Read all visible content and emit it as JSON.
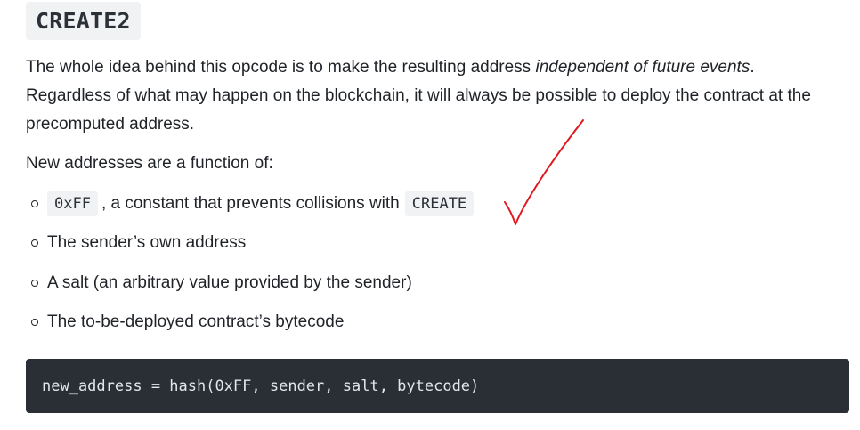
{
  "heading": "CREATE2",
  "intro": {
    "part1": "The whole idea behind this opcode is to make the resulting address ",
    "emphasis": "independent of future events",
    "part2": ". Regardless of what may happen on the blockchain, it will always be possible to deploy the contract at the precomputed address."
  },
  "list_intro": "New addresses are a function of:",
  "items": {
    "item1_code": "0xFF",
    "item1_text": ", a constant that prevents collisions with",
    "item1_code2": "CREATE",
    "item2": "The sender’s own address",
    "item3": "A salt (an arbitrary value provided by the sender)",
    "item4": "The to-be-deployed contract’s bytecode"
  },
  "code_block": "new_address = hash(0xFF, sender, salt, bytecode)",
  "annotation": {
    "icon": "checkmark-icon",
    "color": "#e0191f"
  },
  "colors": {
    "code_bg": "#2a2f36",
    "inline_code_bg": "#f1f2f4"
  }
}
